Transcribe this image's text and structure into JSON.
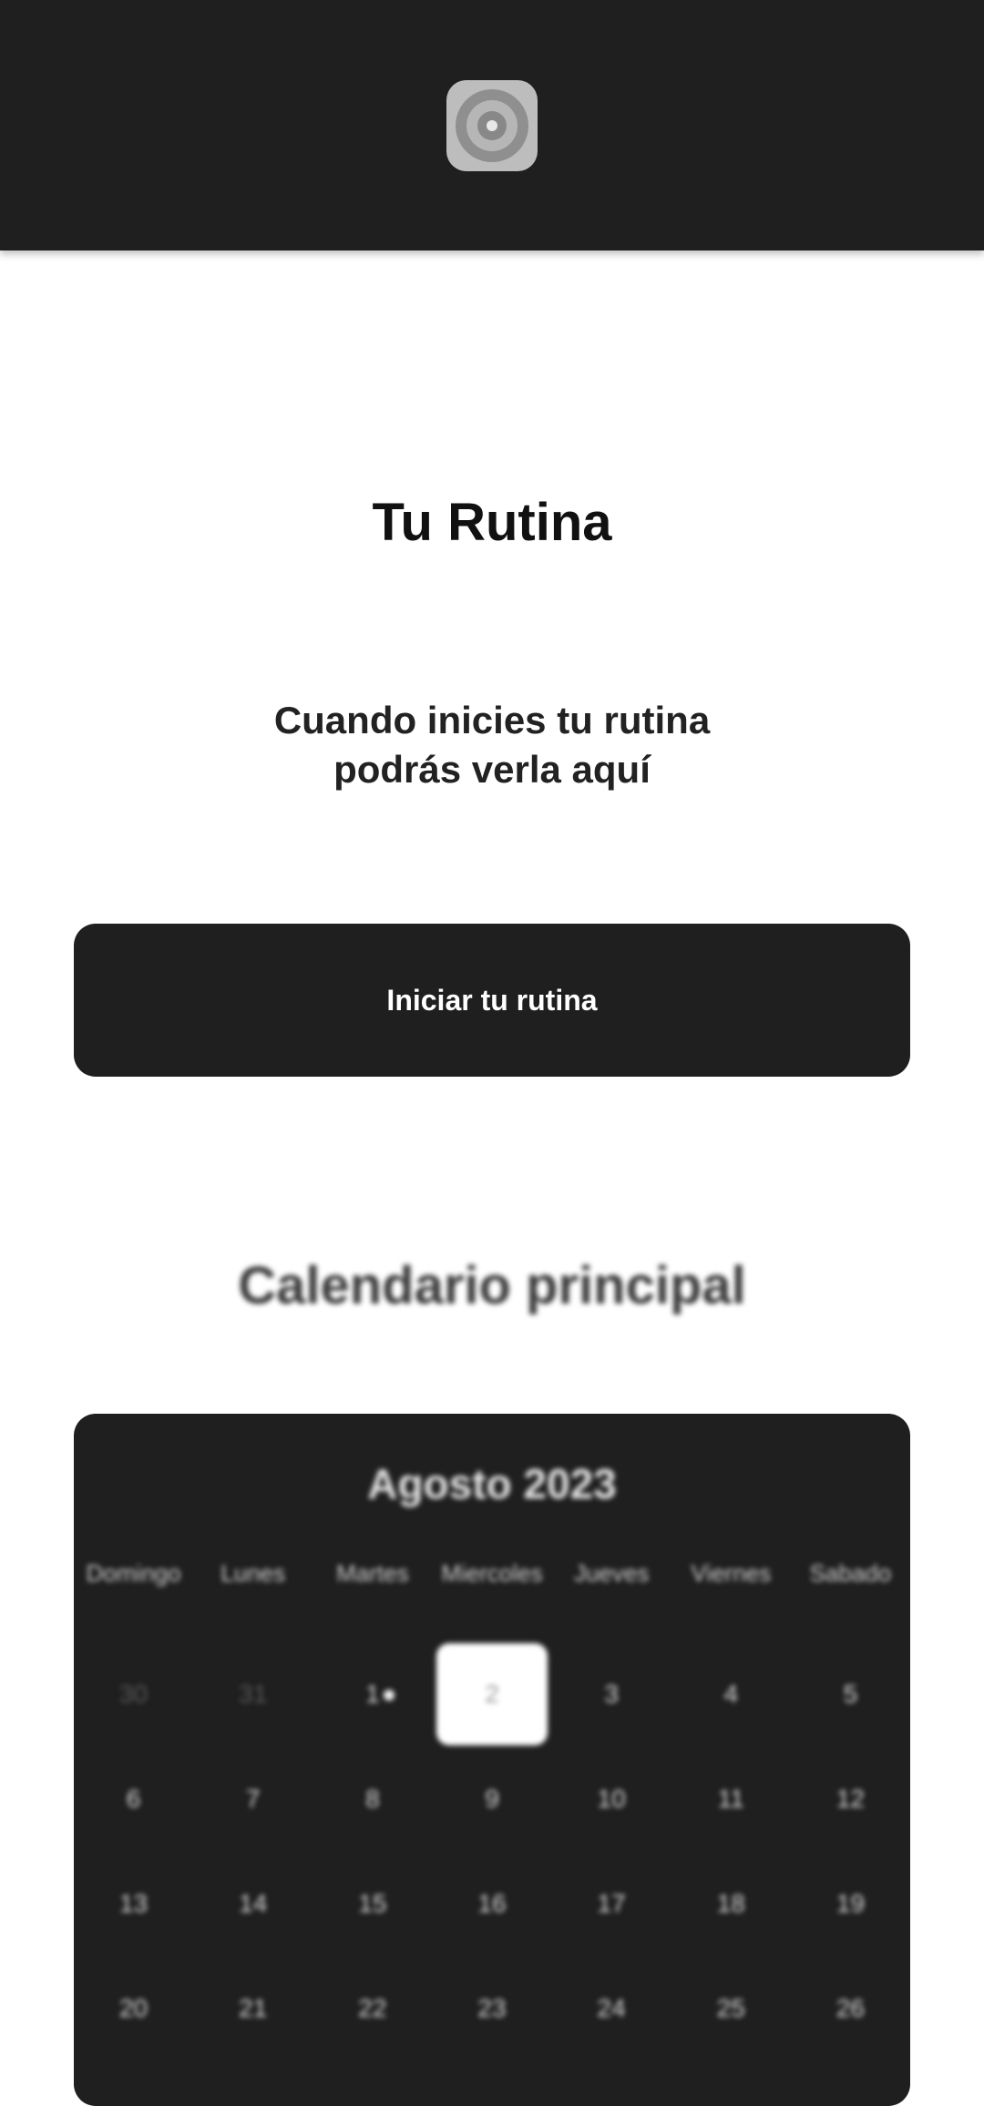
{
  "header": {
    "logo_icon": "mandala-logo-icon"
  },
  "main": {
    "title": "Tu Rutina",
    "subtitle_line1": "Cuando inicies tu rutina",
    "subtitle_line2": "podrás verla aquí",
    "start_button_label": "Iniciar tu rutina"
  },
  "calendar": {
    "heading": "Calendario principal",
    "month_label": "Agosto 2023",
    "weekdays": [
      "Domingo",
      "Lunes",
      "Martes",
      "Miercoles",
      "Jueves",
      "Viernes",
      "Sabado"
    ],
    "weeks": [
      [
        "30",
        "31",
        "1",
        "2",
        "3",
        "4",
        "5"
      ],
      [
        "6",
        "7",
        "8",
        "9",
        "10",
        "11",
        "12"
      ],
      [
        "13",
        "14",
        "15",
        "16",
        "17",
        "18",
        "19"
      ],
      [
        "20",
        "21",
        "22",
        "23",
        "24",
        "25",
        "26"
      ]
    ],
    "selected_day": "2",
    "marked_day": "1"
  },
  "colors": {
    "header_bg": "#1f1f1f",
    "button_bg": "#1f1f1f",
    "calendar_bg": "#1f1f1f",
    "page_bg": "#ffffff"
  }
}
